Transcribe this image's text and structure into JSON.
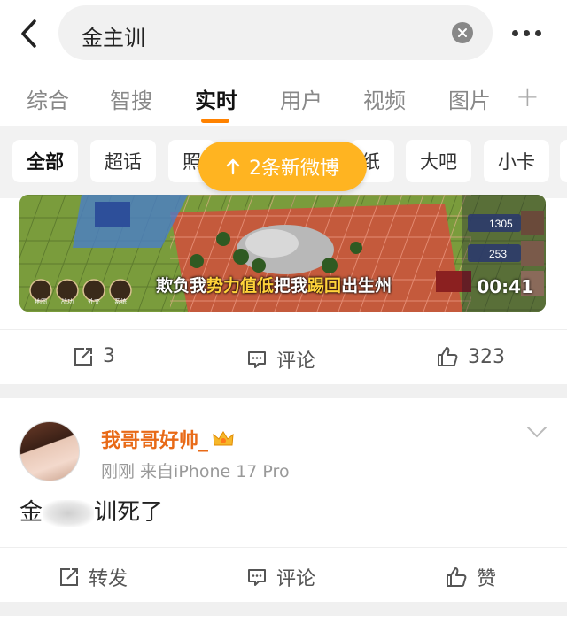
{
  "search": {
    "query": "金主训"
  },
  "tabs": [
    "综合",
    "智搜",
    "实时",
    "用户",
    "视频",
    "图片"
  ],
  "active_tab": "实时",
  "chips": [
    "全部",
    "超话",
    "照",
    "纸",
    "大吧",
    "小卡"
  ],
  "toast": {
    "text": "2条新微博"
  },
  "video_card": {
    "subtitle_plain_1": "欺负我",
    "subtitle_hl_1": "势力值低",
    "subtitle_plain_2": "把我",
    "subtitle_hl_2": "踢回",
    "subtitle_plain_3": "出生州",
    "duration": "00:41",
    "game_scores": [
      "1305",
      "253"
    ],
    "game_menu": [
      "地图",
      "战功",
      "外交",
      "系统"
    ],
    "repost_count": "3",
    "comment_label": "评论",
    "like_count": "323"
  },
  "post": {
    "username": "我哥哥好帅_",
    "meta": "刚刚 来自iPhone 17 Pro",
    "text_start": "金",
    "text_mid": "训",
    "text_end": "死了",
    "repost_label": "转发",
    "comment_label": "评论",
    "like_label": "赞"
  },
  "colors": {
    "accent": "#ff8200",
    "toast": "#ffb421",
    "username": "#e86a17"
  }
}
